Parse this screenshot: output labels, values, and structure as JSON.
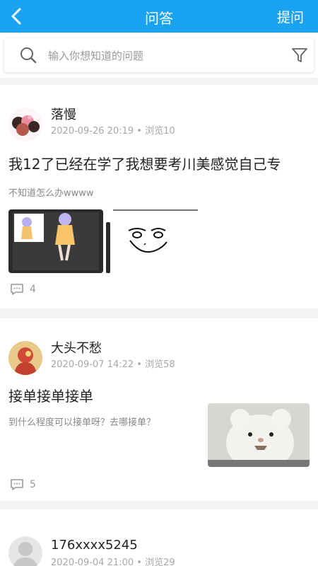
{
  "header": {
    "title": "问答",
    "ask_label": "提问"
  },
  "search": {
    "placeholder": "输入你想知道的问题"
  },
  "posts": [
    {
      "author": "落慢",
      "date": "2020-09-26 20:19",
      "views": "浏览10",
      "title": "我12了已经在学了我想要考川美感觉自己专",
      "desc": "不知道怎么办wwww",
      "comment_count": "4"
    },
    {
      "author": "大头不愁",
      "date": "2020-09-07 14:22",
      "views": "浏览58",
      "title": "接单接单接单",
      "desc": "到什么程度可以接单呀？去哪接单？",
      "comment_count": "5"
    },
    {
      "author": "176xxxx5245",
      "date": "2020-09-04 21:00",
      "views": "浏览29"
    }
  ],
  "colors": {
    "accent": "#1aa3f0"
  }
}
